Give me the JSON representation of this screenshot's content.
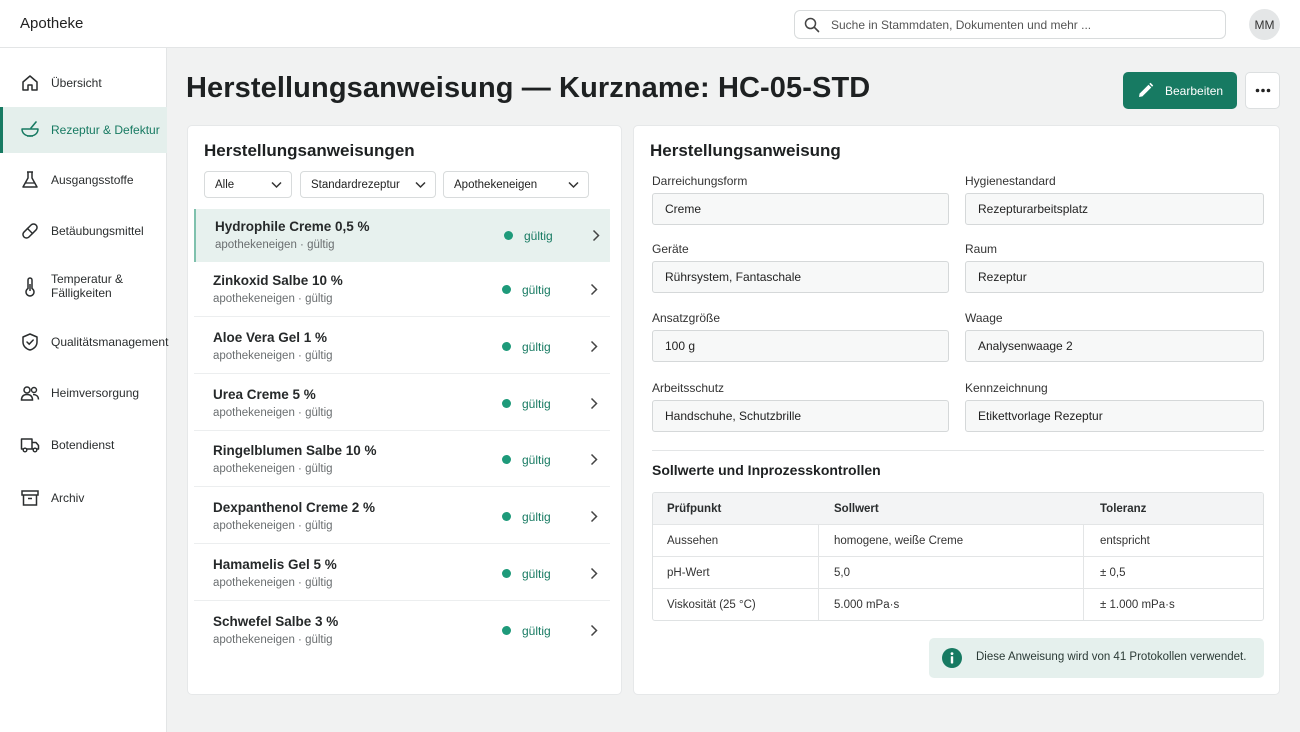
{
  "app": {
    "title": "Apotheke"
  },
  "search": {
    "placeholder": "Suche in Stammdaten, Dokumenten und mehr ..."
  },
  "user": {
    "initials": "MM"
  },
  "sidebar": {
    "items": [
      {
        "label": "Übersicht",
        "icon": "home-icon",
        "active": false
      },
      {
        "label": "Rezeptur & Defektur",
        "icon": "mortar-icon",
        "active": true
      },
      {
        "label": "Ausgangsstoffe",
        "icon": "flask-icon",
        "active": false
      },
      {
        "label": "Betäubungsmittel",
        "icon": "pill-icon",
        "active": false
      },
      {
        "label": "Temperatur &\nFälligkeiten",
        "icon": "thermometer-icon",
        "active": false
      },
      {
        "label": "Qualitätsmanagement",
        "icon": "shield-check-icon",
        "active": false
      },
      {
        "label": "Heimversorgung",
        "icon": "users-icon",
        "active": false
      },
      {
        "label": "Botendienst",
        "icon": "truck-icon",
        "active": false
      },
      {
        "label": "Archiv",
        "icon": "archive-icon",
        "active": false
      }
    ]
  },
  "page": {
    "title": "Herstellungsanweisung — Kurzname: HC-05-STD",
    "edit_label": "Bearbeiten"
  },
  "list_panel": {
    "title": "Herstellungsanweisungen",
    "filters": [
      "Alle",
      "Standardrezeptur",
      "Apothekeneigen"
    ],
    "items": [
      {
        "title": "Hydrophile Creme 0,5 %",
        "subtitle": "apothekeneigen · gültig",
        "status": "gültig"
      },
      {
        "title": "Zinkoxid Salbe 10 %",
        "subtitle": "apothekeneigen · gültig",
        "status": "gültig"
      },
      {
        "title": "Aloe Vera Gel 1 %",
        "subtitle": "apothekeneigen · gültig",
        "status": "gültig"
      },
      {
        "title": "Urea Creme 5 %",
        "subtitle": "apothekeneigen · gültig",
        "status": "gültig"
      },
      {
        "title": "Ringelblumen Salbe 10 %",
        "subtitle": "apothekeneigen · gültig",
        "status": "gültig"
      },
      {
        "title": "Dexpanthenol Creme 2 %",
        "subtitle": "apothekeneigen · gültig",
        "status": "gültig"
      },
      {
        "title": "Hamamelis Gel 5 %",
        "subtitle": "apothekeneigen · gültig",
        "status": "gültig"
      },
      {
        "title": "Schwefel Salbe 3 %",
        "subtitle": "apothekeneigen · gültig",
        "status": "gültig"
      }
    ]
  },
  "detail": {
    "title": "Herstellungsanweisung",
    "fields": [
      {
        "label": "Darreichungsform",
        "value": "Creme"
      },
      {
        "label": "Hygienestandard",
        "value": "Rezepturarbeitsplatz"
      },
      {
        "label": "Geräte",
        "value": "Rührsystem, Fantaschale"
      },
      {
        "label": "Raum",
        "value": "Rezeptur"
      },
      {
        "label": "Ansatzgröße",
        "value": "100 g"
      },
      {
        "label": "Waage",
        "value": "Analysenwaage 2"
      },
      {
        "label": "Arbeitsschutz",
        "value": "Handschuhe, Schutzbrille"
      },
      {
        "label": "Kennzeichnung",
        "value": "Etikettvorlage Rezeptur"
      }
    ],
    "controls": {
      "title": "Sollwerte und Inprozesskontrollen",
      "headers": [
        "Prüfpunkt",
        "Sollwert",
        "Toleranz"
      ],
      "rows": [
        [
          "Aussehen",
          "homogene, weiße Creme",
          "entspricht"
        ],
        [
          "pH-Wert",
          "5,0",
          "± 0,5"
        ],
        [
          "Viskosität (25 °C)",
          "5.000 mPa·s",
          "± 1.000 mPa·s"
        ]
      ]
    },
    "info_note": "Diese Anweisung wird von 41 Protokollen verwendet."
  },
  "colors": {
    "accent": "#177a62",
    "status_dot": "#1e9a7a",
    "selected_bg": "#e7f1ee"
  }
}
